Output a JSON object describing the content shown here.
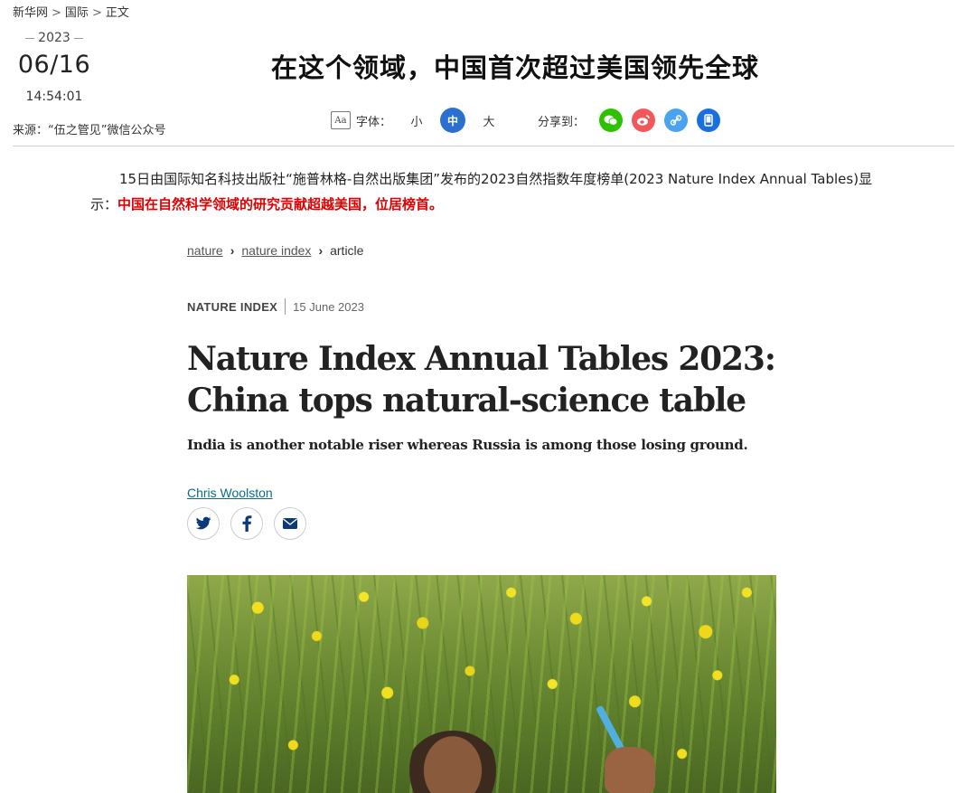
{
  "breadcrumb": [
    "新华网",
    "国际",
    "正文"
  ],
  "date": {
    "year": "2023",
    "month_day": "06/16",
    "time": "14:54:01"
  },
  "source": "来源：“伍之管见”微信公众号",
  "headline": "在这个领域，中国首次超过美国领先全球",
  "toolbar": {
    "font_label": "字体：",
    "font_icon": "Aa",
    "sizes": [
      "小",
      "中",
      "大"
    ],
    "selected_size": "中",
    "share_label": "分享到：",
    "share_icons": [
      {
        "name": "wechat-icon",
        "color": "#2dc100"
      },
      {
        "name": "weibo-icon",
        "color": "#f1585b"
      },
      {
        "name": "link-icon",
        "color": "#4aa3ef"
      },
      {
        "name": "mobile-icon",
        "color": "#1a6fe0"
      }
    ]
  },
  "intro": {
    "text": "15日由国际知名科技出版社“施普林格-自然出版集团”发布的2023自然指数年度榜单(2023 Nature Index Annual Tables)显示：",
    "highlight": "中国在自然科学领域的研究贡献超越美国，位居榜首。"
  },
  "article": {
    "breadcrumb": [
      "nature",
      "nature index",
      "article"
    ],
    "category": "NATURE INDEX",
    "date": "15 June 2023",
    "title": "Nature Index Annual Tables 2023: China tops natural-science table",
    "standfirst": "India is another notable riser whereas Russia is among those losing ground.",
    "author": "Chris Woolston",
    "social": [
      "twitter-icon",
      "facebook-icon",
      "email-icon"
    ]
  },
  "colors": {
    "accent_blue": "#2b6fd0",
    "highlight_red": "#e00000",
    "author_link": "#0a6b8a"
  }
}
